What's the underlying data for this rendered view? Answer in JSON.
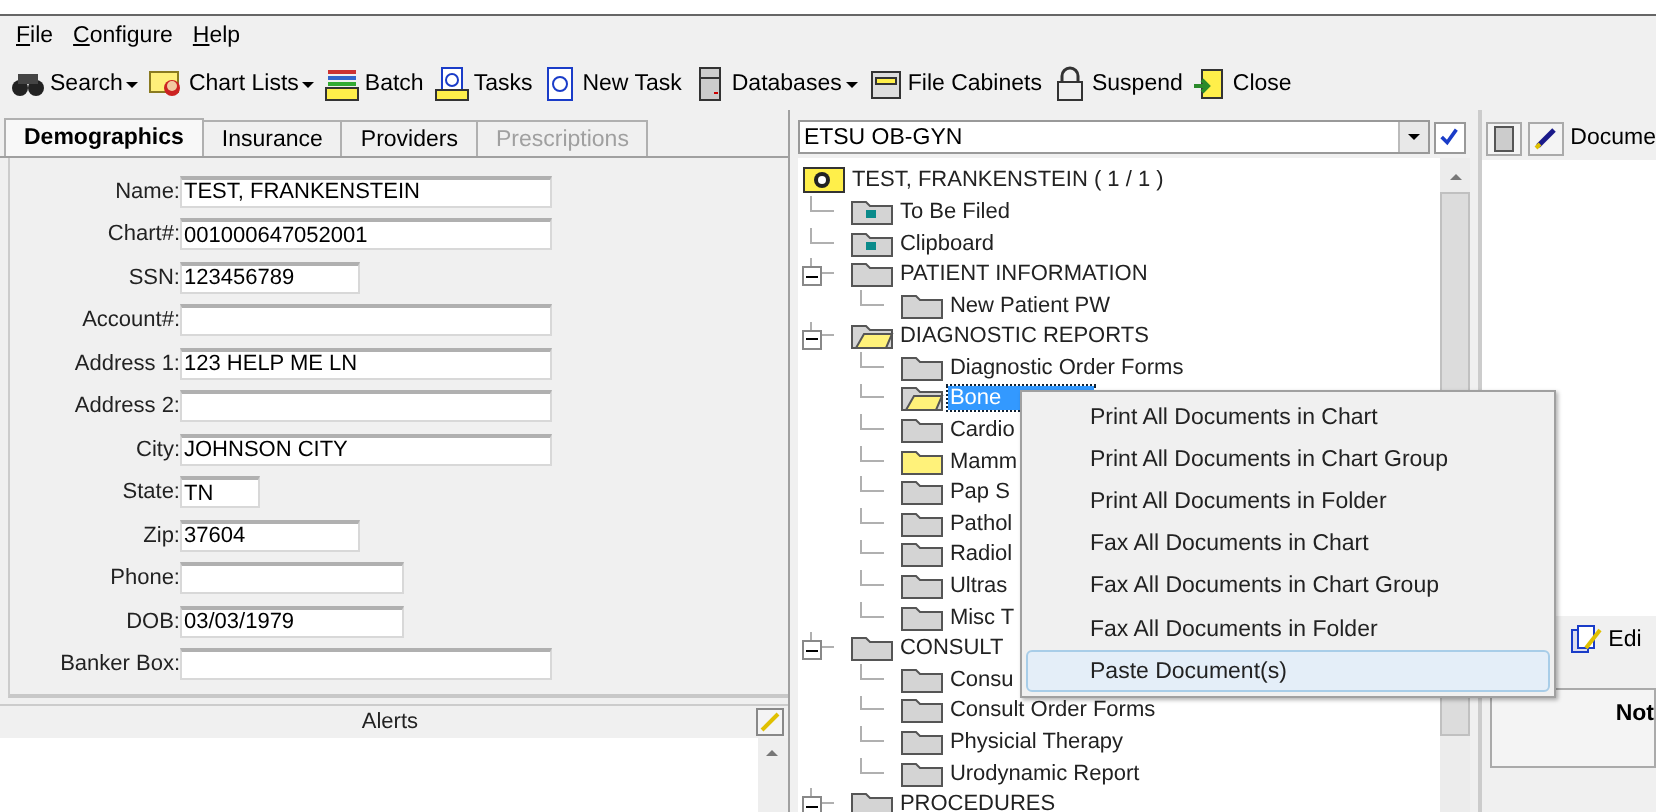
{
  "menu": [
    "File",
    "Configure",
    "Help"
  ],
  "toolbar": [
    {
      "kind": "search",
      "label": "Search",
      "dropdown": true
    },
    {
      "kind": "chart",
      "label": "Chart Lists",
      "dropdown": true
    },
    {
      "kind": "batch",
      "label": "Batch",
      "dropdown": false
    },
    {
      "kind": "tasks",
      "label": "Tasks",
      "dropdown": false
    },
    {
      "kind": "newtask",
      "label": "New Task",
      "dropdown": false
    },
    {
      "kind": "database",
      "label": "Databases",
      "dropdown": true
    },
    {
      "kind": "cabinet",
      "label": "File Cabinets",
      "dropdown": false
    },
    {
      "kind": "lock",
      "label": "Suspend",
      "dropdown": false
    },
    {
      "kind": "close",
      "label": "Close",
      "dropdown": false
    }
  ],
  "tabs": [
    {
      "label": "Demographics",
      "selected": true,
      "disabled": false
    },
    {
      "label": "Insurance",
      "selected": false,
      "disabled": false
    },
    {
      "label": "Providers",
      "selected": false,
      "disabled": false
    },
    {
      "label": "Prescriptions",
      "selected": false,
      "disabled": true
    }
  ],
  "fields": [
    {
      "label": "Name:",
      "value": "TEST, FRANKENSTEIN",
      "kind": "long"
    },
    {
      "label": "Chart#:",
      "value": "001000647052001",
      "kind": "long"
    },
    {
      "label": "SSN:",
      "value": "123456789",
      "kind": "medium"
    },
    {
      "label": "Account#:",
      "kind": "long"
    },
    {
      "label": "Address 1:",
      "value": "123 HELP ME LN",
      "kind": "long"
    },
    {
      "label": "Address 2:",
      "kind": "long"
    },
    {
      "label": "City:",
      "value": "JOHNSON CITY",
      "kind": "long"
    },
    {
      "label": "State:",
      "value": "TN",
      "kind": "tiny"
    },
    {
      "label": "Zip:",
      "value": "37604",
      "kind": "medium"
    },
    {
      "label": "Phone:",
      "kind": "wide"
    },
    {
      "label": "DOB:",
      "value": "03/03/1979",
      "kind": "wide"
    },
    {
      "label": "Banker Box:",
      "kind": "long"
    }
  ],
  "alerts": {
    "title": "Alerts"
  },
  "chart_group": {
    "value": "ETSU OB-GYN"
  },
  "tree": {
    "label": "TEST, FRANKENSTEIN  ( 1 / 1 )",
    "kind": "patient",
    "children": [
      {
        "label": "To Be Filed",
        "kind": "special"
      },
      {
        "label": "Clipboard",
        "kind": "special"
      },
      {
        "label": "PATIENT INFORMATION",
        "kind": "folder",
        "expanded": true,
        "children": [
          {
            "label": "New Patient PW",
            "kind": "folder",
            "selected": false
          }
        ]
      },
      {
        "label": "DIAGNOSTIC REPORTS",
        "kind": "open",
        "expanded": true,
        "children": [
          {
            "label": "Diagnostic Order Forms",
            "kind": "folder",
            "selected": false
          },
          {
            "label": "Bone",
            "kind": "open",
            "selected": true
          },
          {
            "label": "Cardio",
            "kind": "folder",
            "selected": false
          },
          {
            "label": "Mamm",
            "kind": "yellow",
            "selected": false
          },
          {
            "label": "Pap S",
            "kind": "folder",
            "selected": false
          },
          {
            "label": "Pathol",
            "kind": "folder",
            "selected": false
          },
          {
            "label": "Radiol",
            "kind": "folder",
            "selected": false
          },
          {
            "label": "Ultras",
            "kind": "folder",
            "selected": false
          },
          {
            "label": "Misc T",
            "kind": "folder",
            "selected": false
          }
        ]
      },
      {
        "label": "CONSULT",
        "kind": "folder",
        "expanded": true,
        "children": [
          {
            "label": "Consu",
            "kind": "folder",
            "selected": false
          },
          {
            "label": "Consult Order Forms",
            "kind": "folder",
            "selected": false
          },
          {
            "label": "Physicial Therapy",
            "kind": "folder",
            "selected": false
          },
          {
            "label": "Urodynamic Report",
            "kind": "folder",
            "selected": false
          }
        ]
      },
      {
        "label": "PROCEDURES",
        "kind": "folder",
        "expanded": true
      }
    ]
  },
  "context_menu": [
    {
      "label": "Print All Documents in Chart",
      "selected": false
    },
    {
      "label": "Print All Documents in Chart Group",
      "selected": false
    },
    {
      "label": "Print All Documents in Folder",
      "selected": false
    },
    {
      "label": "Fax All Documents in Chart",
      "selected": false
    },
    {
      "label": "Fax All Documents in Chart Group",
      "selected": false
    },
    {
      "label": "Fax All Documents in Folder",
      "selected": false
    },
    {
      "label": "Paste Document(s)",
      "selected": true
    }
  ],
  "document_panel": {
    "toolbar_label": "Docume",
    "edit_label": "Edi",
    "notes_header": "Not"
  }
}
